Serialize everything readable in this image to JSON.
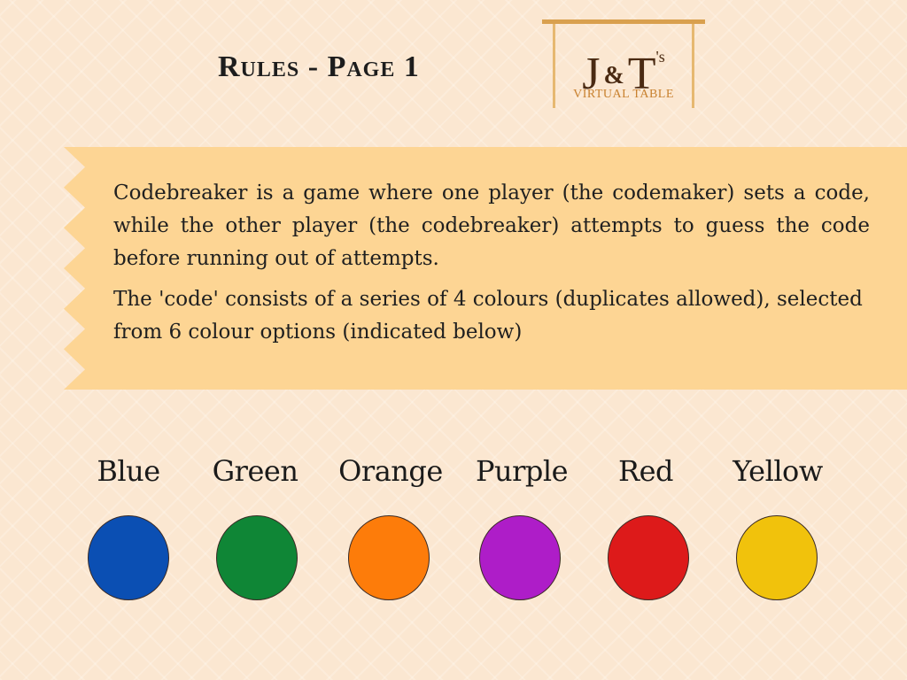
{
  "page": {
    "title": "Rules - Page 1"
  },
  "logo": {
    "letter_j": "J",
    "ampersand": "&",
    "letter_t": "T",
    "suffix": "'s",
    "subtitle": "VIRTUAL TABLE",
    "frame_color": "#d9a04e",
    "text_color": "#4a2a12",
    "subtitle_color": "#c8812f"
  },
  "rules": {
    "paragraph_1": "Codebreaker is a game where one player (the codemaker) sets a code, while the other player (the codebreaker) attempts to guess the code before running out of attempts.",
    "paragraph_2": "The 'code' consists of a series of 4 colours (duplicates allowed), selected from 6 colour options (indicated below)",
    "banner_color": "#fdd594"
  },
  "colours": [
    {
      "label": "Blue",
      "color": "#0b4fb3"
    },
    {
      "label": "Green",
      "color": "#0f8636"
    },
    {
      "label": "Orange",
      "color": "#fd7c0a"
    },
    {
      "label": "Purple",
      "color": "#ae1dc8"
    },
    {
      "label": "Red",
      "color": "#dd1a1a"
    },
    {
      "label": "Yellow",
      "color": "#f1c20c"
    }
  ],
  "background_color": "#fbe7d1"
}
